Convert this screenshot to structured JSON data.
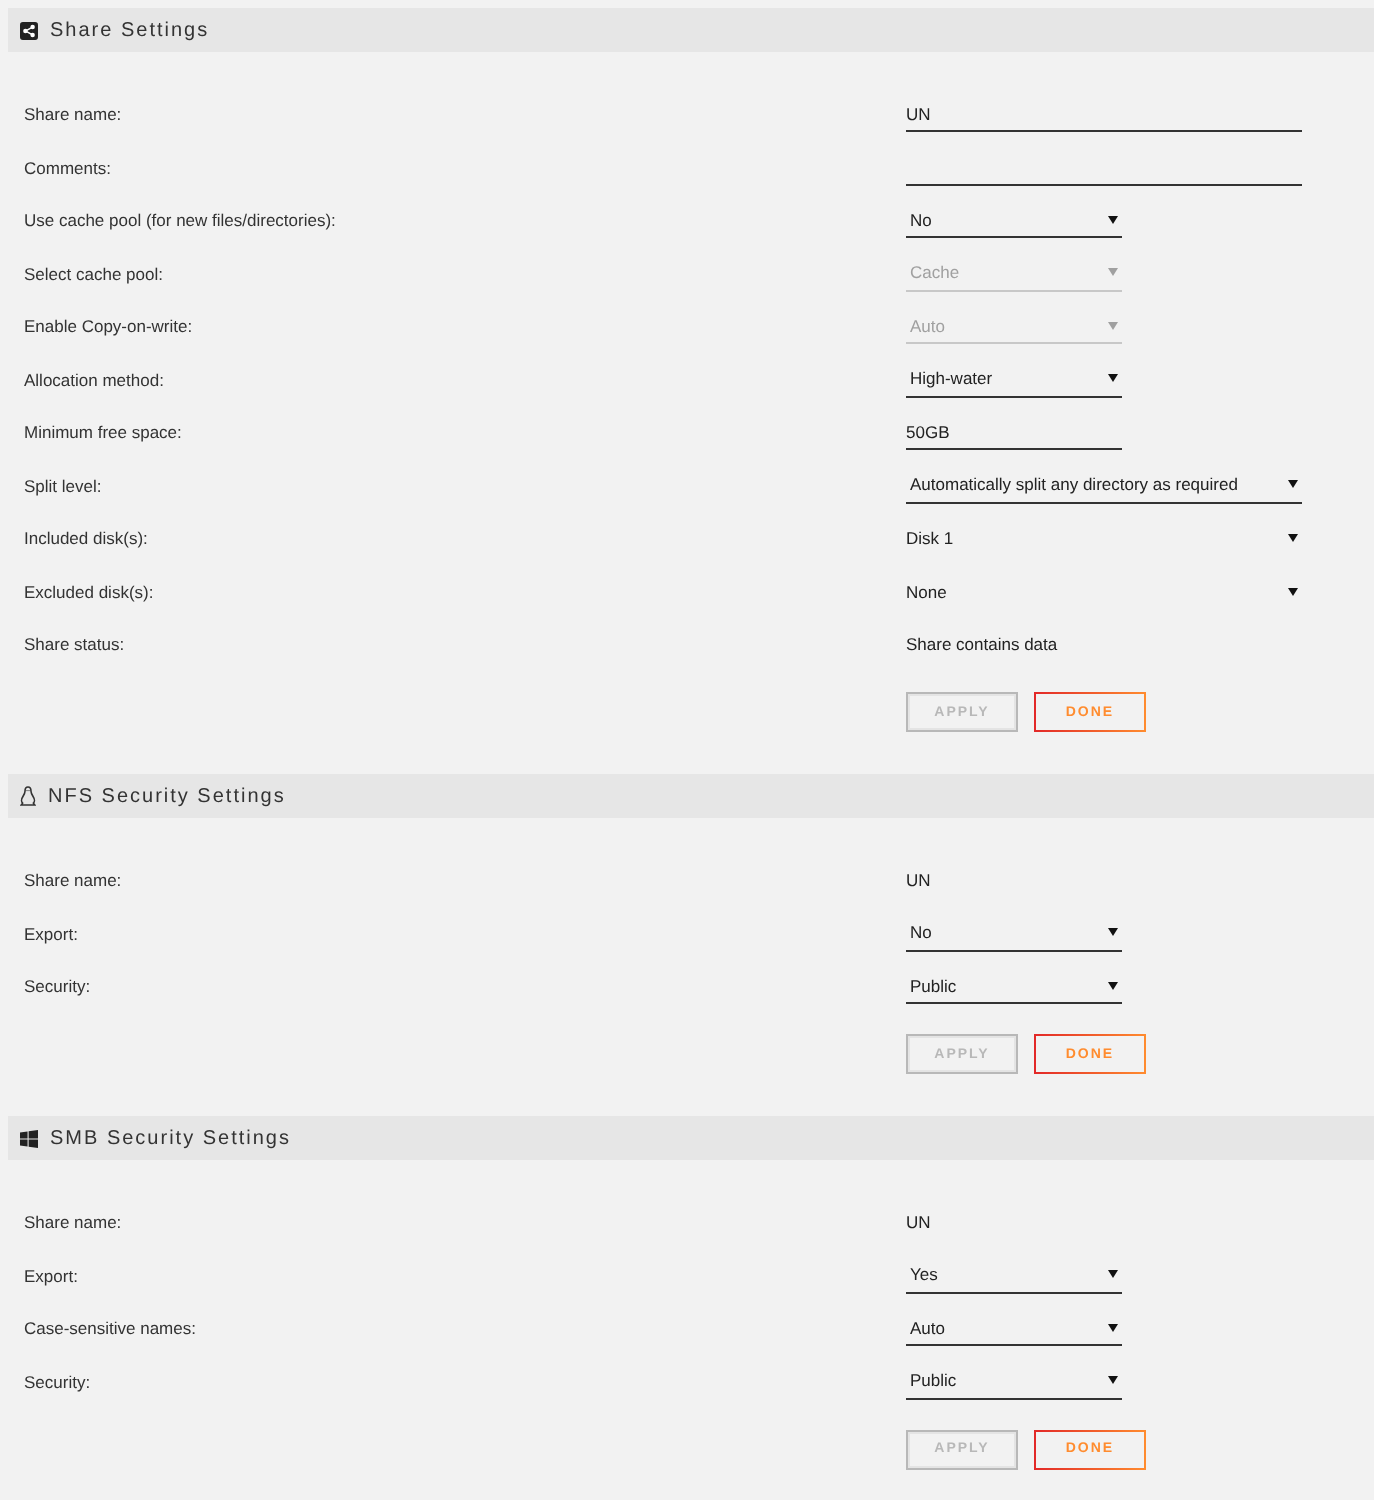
{
  "sections": [
    {
      "title": "Share Settings",
      "rows": [
        {
          "label": "Share name:",
          "field": {
            "kind": "input",
            "value": "UN"
          }
        },
        {
          "label": "Comments:",
          "field": {
            "kind": "input"
          }
        },
        {
          "label": "Use cache pool (for new files/directories):",
          "field": {
            "kind": "select",
            "value": "No",
            "disabled": false
          }
        },
        {
          "label": "Select cache pool:",
          "field": {
            "kind": "select",
            "value": "Cache",
            "disabled": true
          }
        },
        {
          "label": "Enable Copy-on-write:",
          "field": {
            "kind": "select",
            "value": "Auto",
            "disabled": true
          }
        },
        {
          "label": "Allocation method:",
          "field": {
            "kind": "select",
            "value": "High-water",
            "disabled": false
          }
        },
        {
          "label": "Minimum free space:",
          "field": {
            "kind": "short-input",
            "value": "50GB"
          }
        },
        {
          "label": "Split level:",
          "field": {
            "kind": "wide-select",
            "value": "Automatically split any directory as required",
            "disabled": false
          }
        },
        {
          "label": "Included disk(s):",
          "field": {
            "kind": "checklist",
            "value": "Disk 1"
          }
        },
        {
          "label": "Excluded disk(s):",
          "field": {
            "kind": "checklist",
            "value": "None"
          }
        },
        {
          "label": "Share status:",
          "field": {
            "kind": "text",
            "value": "Share contains data"
          }
        }
      ],
      "buttons": [
        {
          "label": "APPLY",
          "disabled": true
        },
        {
          "label": "DONE",
          "disabled": false
        }
      ]
    },
    {
      "title": "NFS Security Settings",
      "rows": [
        {
          "label": "Share name:",
          "field": {
            "kind": "text",
            "value": "UN"
          }
        },
        {
          "label": "Export:",
          "field": {
            "kind": "select",
            "value": "No",
            "disabled": false
          }
        },
        {
          "label": "Security:",
          "field": {
            "kind": "select",
            "value": "Public",
            "disabled": false
          }
        }
      ],
      "buttons": [
        {
          "label": "APPLY",
          "disabled": true
        },
        {
          "label": "DONE",
          "disabled": false
        }
      ]
    },
    {
      "title": "SMB Security Settings",
      "rows": [
        {
          "label": "Share name:",
          "field": {
            "kind": "text",
            "value": "UN"
          }
        },
        {
          "label": "Export:",
          "field": {
            "kind": "select",
            "value": "Yes",
            "disabled": false
          }
        },
        {
          "label": "Case-sensitive names:",
          "field": {
            "kind": "select",
            "value": "Auto",
            "disabled": false
          }
        },
        {
          "label": "Security:",
          "field": {
            "kind": "select",
            "value": "Public",
            "disabled": false
          }
        }
      ],
      "buttons": [
        {
          "label": "APPLY",
          "disabled": true
        },
        {
          "label": "DONE",
          "disabled": false
        }
      ]
    }
  ]
}
